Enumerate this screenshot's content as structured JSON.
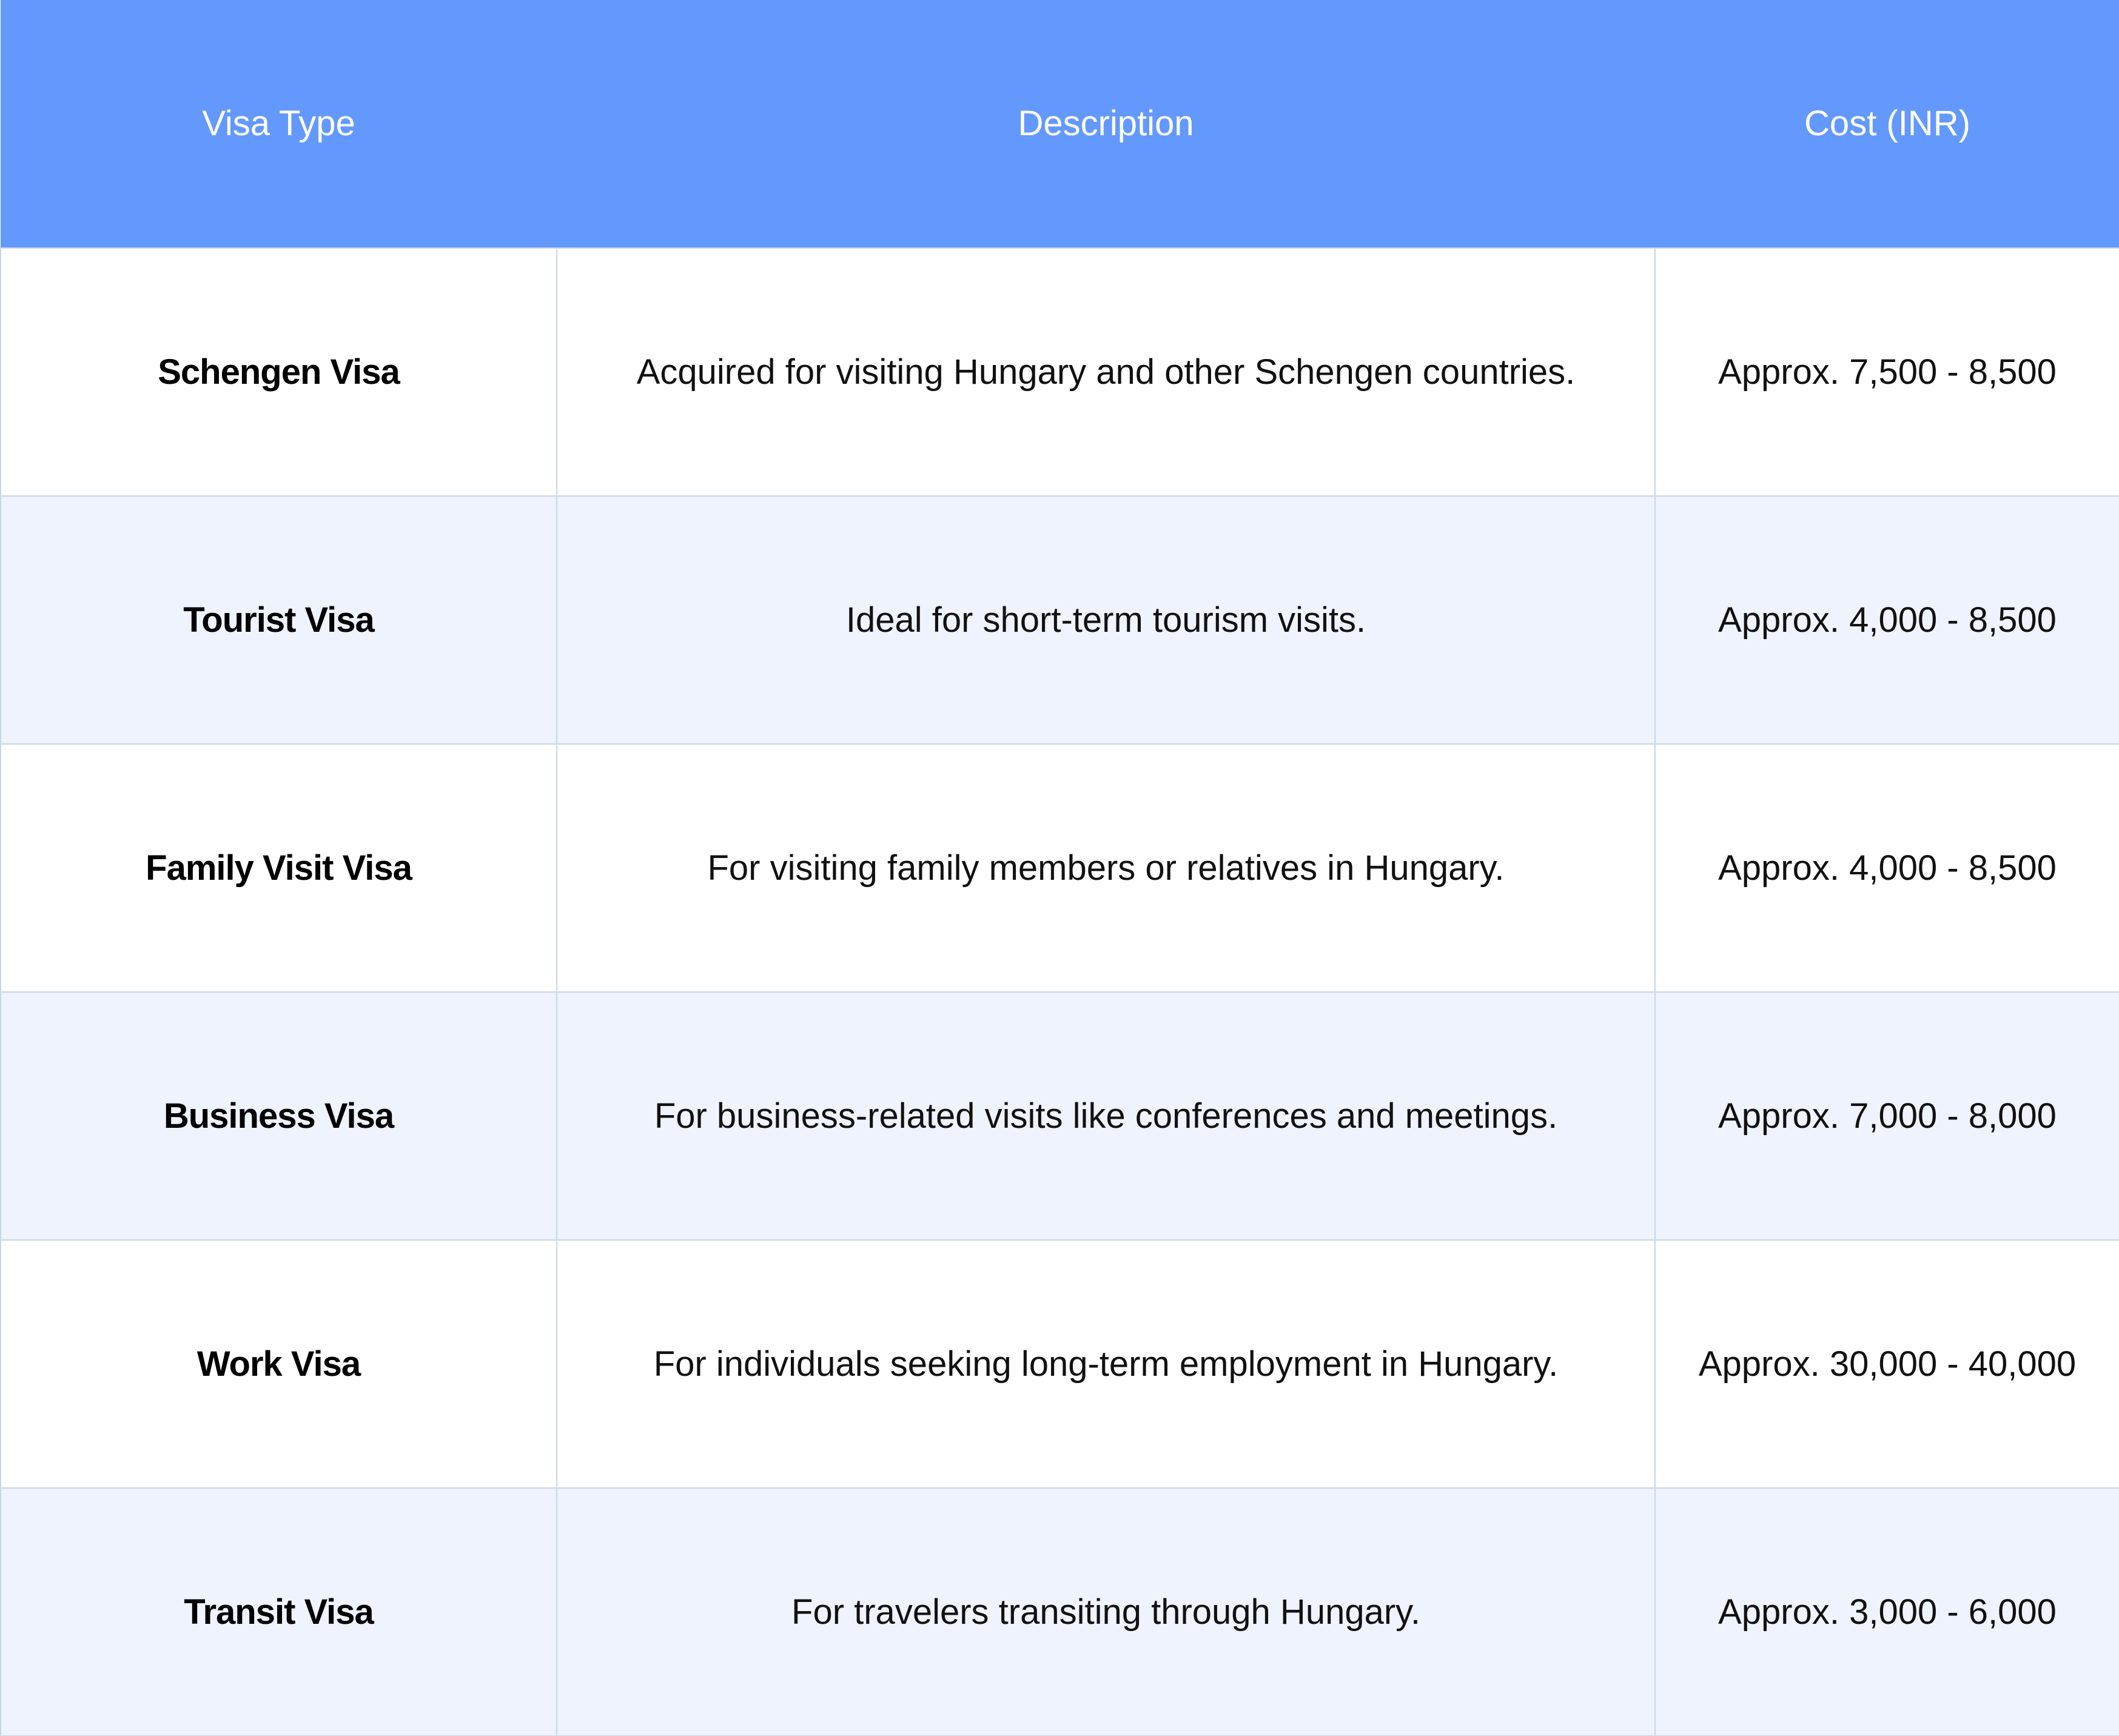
{
  "chart_data": {
    "type": "table",
    "columns": [
      "Visa Type",
      "Description",
      "Cost (INR)"
    ],
    "rows": [
      {
        "type": "Schengen Visa",
        "description": "Acquired for visiting Hungary and other Schengen countries.",
        "cost": "Approx. 7,500 - 8,500"
      },
      {
        "type": "Tourist Visa",
        "description": "Ideal for short-term tourism visits.",
        "cost": "Approx. 4,000 - 8,500"
      },
      {
        "type": "Family Visit Visa",
        "description": "For visiting family members or relatives in Hungary.",
        "cost": "Approx. 4,000 - 8,500"
      },
      {
        "type": "Business Visa",
        "description": "For business-related visits like conferences and meetings.",
        "cost": "Approx. 7,000 - 8,000"
      },
      {
        "type": "Work Visa",
        "description": "For individuals seeking long-term employment in Hungary.",
        "cost": "Approx. 30,000 - 40,000"
      },
      {
        "type": "Transit Visa",
        "description": "For travelers transiting through Hungary.",
        "cost": "Approx. 3,000 - 6,000"
      }
    ]
  },
  "colors": {
    "header_background": "#6399fd",
    "header_text": "#ffffff",
    "alt_row_background": "#eef3fe",
    "row_background": "#ffffff",
    "border": "#c7d6e4"
  }
}
